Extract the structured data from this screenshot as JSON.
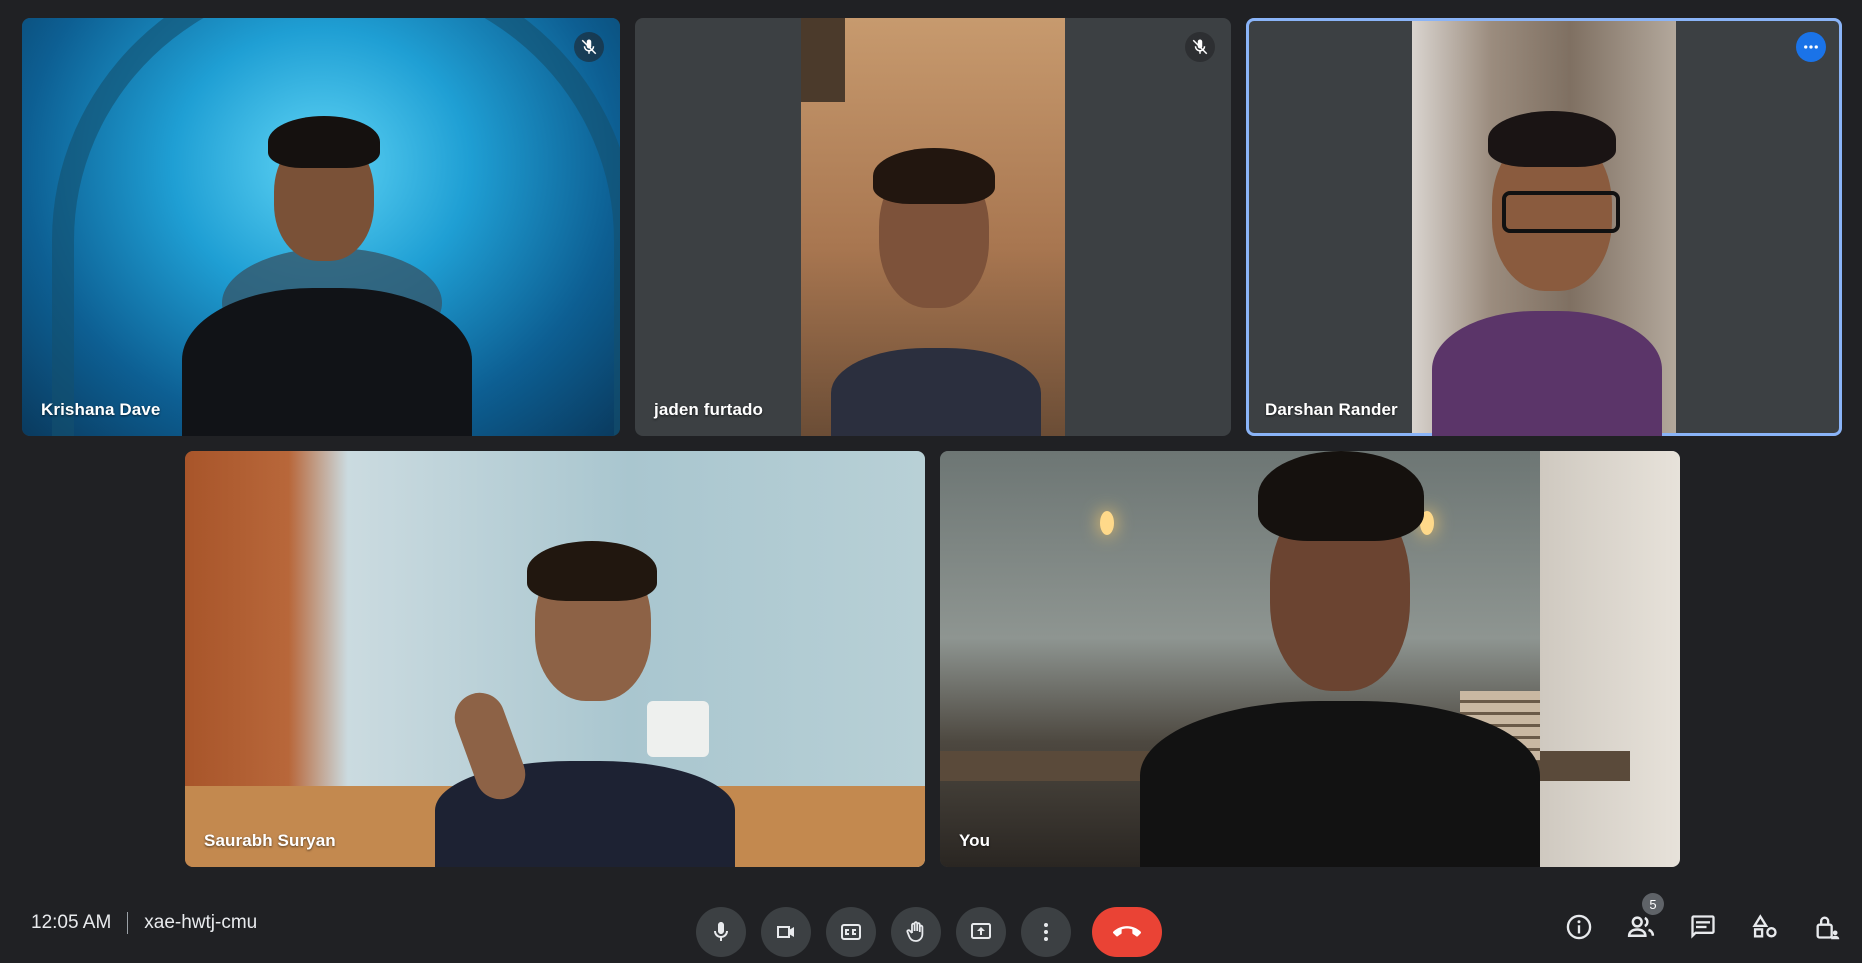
{
  "participants": [
    {
      "name": "Krishana Dave",
      "status_icon": "mic-off-icon"
    },
    {
      "name": "jaden furtado",
      "status_icon": "mic-off-icon"
    },
    {
      "name": "Darshan Rander",
      "status_icon": "more-options-icon"
    },
    {
      "name": "Saurabh Suryan"
    },
    {
      "name": "You"
    }
  ],
  "meeting": {
    "time": "12:05 AM",
    "code": "xae-hwtj-cmu"
  },
  "controls": [
    {
      "icon": "microphone-icon"
    },
    {
      "icon": "camera-icon"
    },
    {
      "icon": "closed-captions-icon"
    },
    {
      "icon": "raise-hand-icon"
    },
    {
      "icon": "present-screen-icon"
    },
    {
      "icon": "more-options-icon"
    },
    {
      "icon": "leave-call-icon"
    }
  ],
  "tools": {
    "people_count": "5"
  },
  "colors": {
    "background": "#202124",
    "tile": "#3c4043",
    "active_border": "#8ab4f8",
    "end_call": "#ea4335",
    "accent": "#1a73e8"
  }
}
